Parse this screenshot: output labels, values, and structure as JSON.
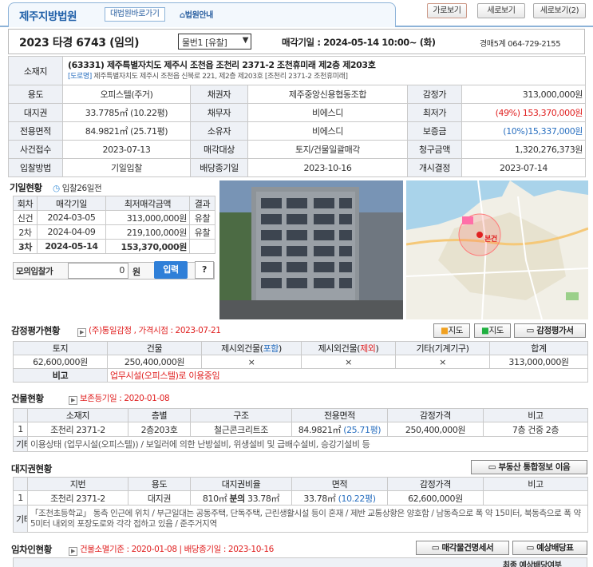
{
  "header": {
    "court": "제주지방법원",
    "btn_home": "대법원바로가기",
    "btn_guide": "법원안내",
    "view_h": "가로보기",
    "view_v": "세로보기",
    "view_v2": "세로보기(2)"
  },
  "case": {
    "number": "2023 타경 6743 (임의)",
    "lot_select": "물번1 [유찰]",
    "auction_date": "매각기일 : 2024-05-14 10:00~ (화)",
    "dept": "경매5계 064-729-2155"
  },
  "location": {
    "label": "소재지",
    "address": "(63331) 제주특별자치도 제주시 조천읍 조천리 2371-2 조천휴미래 제2층 제203호",
    "road_tag": "[도로명]",
    "road": "제주특별자치도 제주시 조천읍 신북로 221, 제2층 제203호 [조천리 2371-2 조천휴미래]"
  },
  "info": [
    [
      "용도",
      "오피스텔(주거)",
      "채권자",
      "제주중앙신용협동조합",
      "감정가",
      "313,000,000원"
    ],
    [
      "대지권",
      "33.7785㎡ (10.22평)",
      "채무자",
      "비에스디",
      "최저가",
      "(49%) 153,370,000원"
    ],
    [
      "전용면적",
      "84.9821㎡ (25.71평)",
      "소유자",
      "비에스디",
      "보증금",
      "(10%)15,337,000원"
    ],
    [
      "사건접수",
      "2023-07-13",
      "매각대상",
      "토지/건물일괄매각",
      "청구금액",
      "1,320,276,373원"
    ],
    [
      "입찰방법",
      "기일입찰",
      "배당종기일",
      "2023-10-16",
      "개시결정",
      "2023-07-14"
    ]
  ],
  "bidding": {
    "title": "기일현황",
    "sub": "입찰26일전",
    "headers": [
      "회차",
      "매각기일",
      "최저매각금액",
      "결과"
    ],
    "rows": [
      [
        "신건",
        "2024-03-05",
        "313,000,000원",
        "유찰"
      ],
      [
        "2차",
        "2024-04-09",
        "219,100,000원",
        "유찰"
      ],
      [
        "3차",
        "2024-05-14",
        "153,370,000원",
        ""
      ]
    ],
    "mock_label": "모의입찰가",
    "mock_value": "0",
    "mock_unit": "원",
    "btn_input": "입력",
    "btn_help": "?"
  },
  "map": {
    "marker": "본건"
  },
  "appraisal": {
    "title": "감정평가현황",
    "org": "(주)통일감정 , 가격시점 : 2023-07-21",
    "btn_dmap": "지도",
    "btn_nmap": "지도",
    "btn_doc": "감정평가서",
    "headers": [
      "토지",
      "건물",
      "제시외건물(포함)",
      "제시외건물(제외)",
      "기타(기계기구)",
      "합계"
    ],
    "values": [
      "62,600,000원",
      "250,400,000원",
      "×",
      "×",
      "×",
      "313,000,000원"
    ],
    "note_label": "비고",
    "note": "업무시설(오피스텔)로 이용중임"
  },
  "building": {
    "title": "건물현황",
    "sub": "보존등기일 : 2020-01-08",
    "headers": [
      "소재지",
      "층별",
      "구조",
      "전용면적",
      "감정가격",
      "비고"
    ],
    "row": [
      "1",
      "조천리 2371-2",
      "2층203호",
      "철근콘크리트조",
      "84.9821㎡ (25.71평)",
      "250,400,000원",
      "7층 건중 2층"
    ],
    "etc_label": "기타",
    "etc": "이용상태 (업무시설(오피스텔)) / 보일러에 의한 난방설비, 위생설비 및 급배수설비, 승강기설비 등"
  },
  "land": {
    "title": "대지권현황",
    "btn": "부동산 통합정보 이음",
    "headers": [
      "지번",
      "용도",
      "대지권비율",
      "면적",
      "감정가격",
      "비고"
    ],
    "row": [
      "1",
      "조천리 2371-2",
      "대지권",
      "810㎡ 분의 33.78㎡",
      "33.78㎡ (10.22평)",
      "62,600,000원",
      ""
    ],
    "etc_label": "기타",
    "etc": "「조천초등학교」 동측 인근에 위치 / 부근일대는 공동주택, 단독주택, 근린생활시설 등이 혼재 / 제반 교통상황은 양호함 / 남동측으로 폭 약 15미터, 북동측으로 폭 약 5미터 내외의 포장도로와 각각 접하고 있음 / 준주거지역"
  },
  "tenant": {
    "title": "임차인현황",
    "sub": "건물소멸기준 : 2020-01-08 | 배당종기일 : 2023-10-16",
    "btn_list": "매각물건명세서",
    "btn_div": "예상배당표",
    "col_last": "최종 예상배당여부"
  }
}
